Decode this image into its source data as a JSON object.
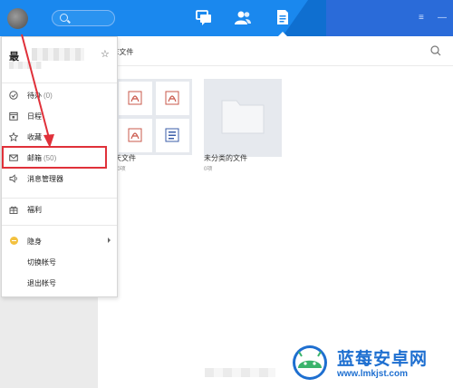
{
  "header": {
    "nav_icons": [
      "chat-bubbles-icon",
      "contacts-icon",
      "files-icon"
    ],
    "active_tab": "files",
    "window_controls": {
      "menu": "≡",
      "minimize": "—"
    },
    "colors": {
      "bar": "#1a88ee",
      "bar_dark": "#2a6bd9"
    }
  },
  "menu": {
    "user_name": "最",
    "items": [
      {
        "label": "待办",
        "count": "(0)",
        "icon": "check-circle-icon"
      },
      {
        "label": "日程",
        "count": "",
        "icon": "calendar-icon"
      },
      {
        "label": "收藏",
        "count": "",
        "icon": "star-outline-icon"
      },
      {
        "label": "邮箱",
        "count": "(50)",
        "icon": "mail-icon"
      },
      {
        "label": "消息管理器",
        "count": "",
        "icon": "speaker-icon"
      },
      {
        "label": "福利",
        "count": "",
        "icon": "gift-icon"
      },
      {
        "label": "隐身",
        "count": "",
        "icon": "status-dot-icon"
      },
      {
        "label": "切换帐号",
        "count": "",
        "icon": ""
      },
      {
        "label": "退出帐号",
        "count": "",
        "icon": ""
      }
    ]
  },
  "main": {
    "breadcrumb": "E文件",
    "folders": [
      {
        "name": "天文件",
        "count": "90项"
      },
      {
        "name": "未分类的文件",
        "count": "0项"
      }
    ]
  },
  "annotation": {
    "color": "#e0313a"
  },
  "watermark": {
    "title": "蓝莓安卓网",
    "url": "www.lmkjst.com"
  }
}
